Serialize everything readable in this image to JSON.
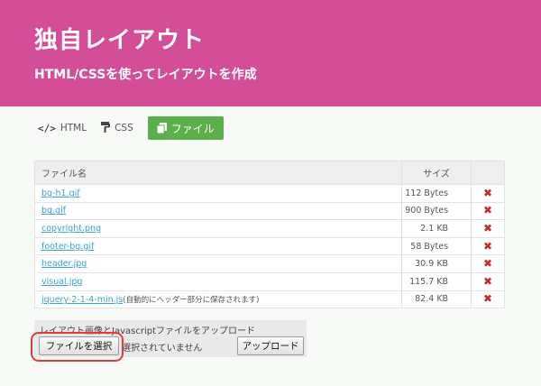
{
  "header": {
    "title": "独自レイアウト",
    "subtitle": "HTML/CSSを使ってレイアウトを作成",
    "bg_color": "#d44d97"
  },
  "tabs": [
    {
      "label": "HTML",
      "icon": "code-icon",
      "active": false
    },
    {
      "label": "CSS",
      "icon": "paint-roller-icon",
      "active": false
    },
    {
      "label": "ファイル",
      "icon": "files-icon",
      "active": true
    }
  ],
  "file_table": {
    "headers": {
      "name": "ファイル名",
      "size": "サイズ"
    },
    "rows": [
      {
        "name": "bg-h1.gif",
        "size": "112 Bytes",
        "note": ""
      },
      {
        "name": "bg.gif",
        "size": "900 Bytes",
        "note": ""
      },
      {
        "name": "copyright.png",
        "size": "2.1 KB",
        "note": ""
      },
      {
        "name": "footer-bg.gif",
        "size": "58 Bytes",
        "note": ""
      },
      {
        "name": "header.jpg",
        "size": "30.9 KB",
        "note": ""
      },
      {
        "name": "visual.jpg",
        "size": "115.7 KB",
        "note": ""
      },
      {
        "name": "jquery-2-1-4-min.js",
        "size": "82.4 KB",
        "note": "(自動的にヘッダー部分に保存されます)"
      }
    ],
    "delete_icon": "delete-x-icon",
    "delete_color": "#c62a2a",
    "link_color": "#3a9fd6"
  },
  "upload": {
    "label": "レイアウト画像とJavascriptファイルをアップロード",
    "choose_button": "ファイルを選択",
    "no_file_text": "選択されていません",
    "upload_button": "アップロード"
  },
  "accent": {
    "active_tab": "#5bb04c",
    "highlight_ring": "#e23b3b"
  }
}
